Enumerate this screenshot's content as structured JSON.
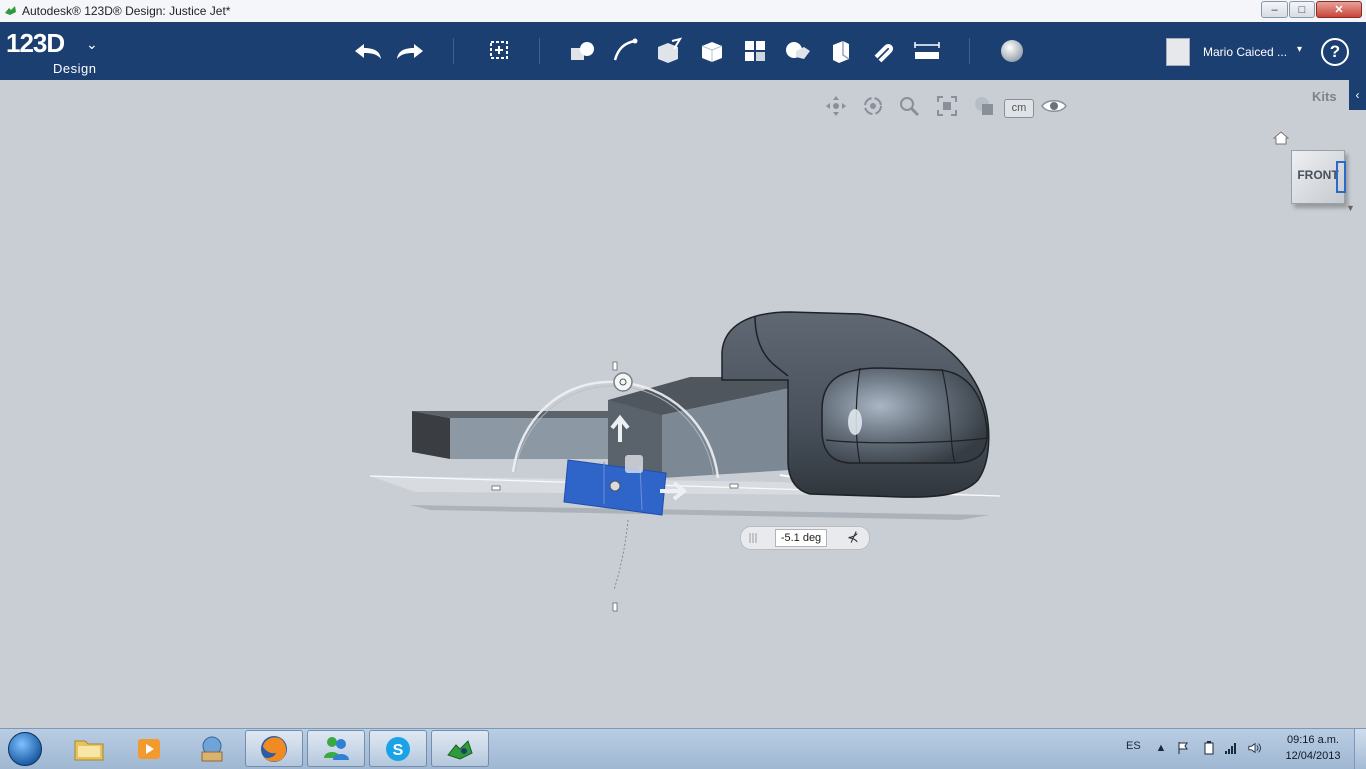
{
  "window": {
    "title": "Autodesk® 123D® Design: Justice Jet*",
    "minimize": "–",
    "maximize": "□",
    "close": "✕"
  },
  "toolbar": {
    "logo_main": "123D",
    "logo_sub": "Design",
    "logo_menu": "⌄",
    "user_name": "Mario Caiced ...",
    "user_menu": "▾",
    "help": "?"
  },
  "viewport": {
    "units_button": "cm",
    "kits_label": "Kits",
    "kits_toggle": "‹",
    "viewcube_face": "FRONT",
    "viewcube_menu": "▼"
  },
  "rotate_tool": {
    "angle_value": "-5.1 deg",
    "snap_icon": "⊀"
  },
  "taskbar": {
    "language": "ES",
    "time": "09:16 a.m.",
    "date": "12/04/2013"
  },
  "colors": {
    "toolbar": "#1c3f72",
    "viewport": "#c9ced4",
    "selection": "#2f64c8",
    "model_dark": "#3c4146",
    "model_mid": "#6d7782"
  }
}
